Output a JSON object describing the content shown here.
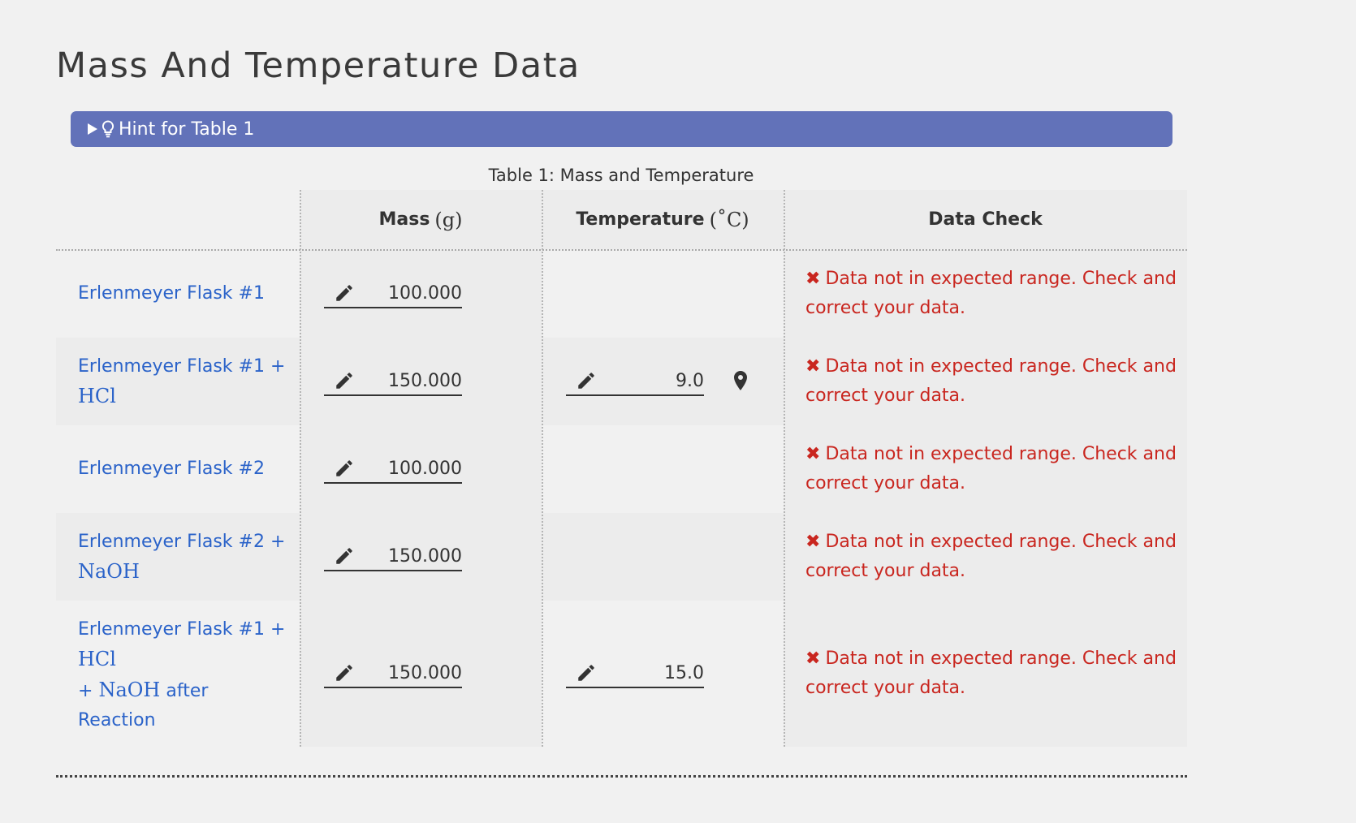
{
  "page_title": "Mass And Temperature Data",
  "hint": {
    "label": "Hint for Table 1"
  },
  "table": {
    "caption": "Table 1: Mass and Temperature",
    "headers": {
      "mass": "Mass",
      "mass_unit": "(g)",
      "temperature": "Temperature",
      "temperature_unit": "(˚C)",
      "data_check": "Data Check"
    },
    "rows": [
      {
        "label": "Erlenmeyer Flask #1",
        "mass": "100.000",
        "temperature": "",
        "check": "Data not in expected range. Check and correct your data."
      },
      {
        "label": "Erlenmeyer Flask #1 +",
        "chem": "HCl",
        "mass": "150.000",
        "temperature": "9.0",
        "check": "Data not in expected range. Check and correct your data."
      },
      {
        "label": "Erlenmeyer Flask #2",
        "mass": "100.000",
        "temperature": "",
        "check": "Data not in expected range. Check and correct your data."
      },
      {
        "label": "Erlenmeyer Flask #2 +",
        "chem": "NaOH",
        "mass": "150.000",
        "temperature": "",
        "check": "Data not in expected range. Check and correct your data."
      },
      {
        "label": "Erlenmeyer Flask #1 +",
        "chem": "HCl",
        "label_plus": "+",
        "chem2": "NaOH",
        "label_after": "after",
        "label_end": "Reaction",
        "mass": "150.000",
        "temperature": "15.0",
        "check": "Data not in expected range. Check and correct your data."
      }
    ],
    "check_icon": "✖"
  },
  "colors": {
    "hint_bar": "#6272b9",
    "link": "#2b63c9",
    "error": "#c9261f"
  }
}
